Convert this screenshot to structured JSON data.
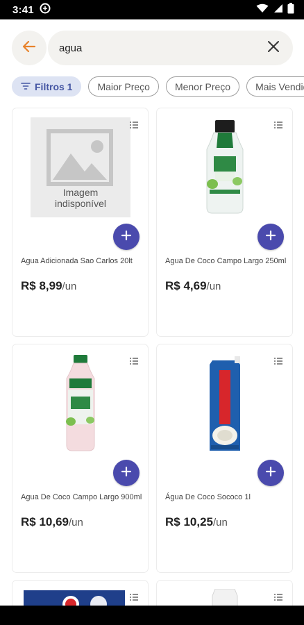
{
  "status_bar": {
    "time": "3:41",
    "icons": [
      "circle-app-icon",
      "wifi-icon",
      "signal-icon",
      "battery-icon"
    ]
  },
  "search": {
    "back_icon": "arrow-left-icon",
    "query": "agua",
    "clear_icon": "close-icon",
    "accent_color": "#e8822a"
  },
  "filters": {
    "chips": [
      {
        "label": "Filtros 1",
        "active": true,
        "icon": "filter-icon"
      },
      {
        "label": "Maior Preço",
        "active": false
      },
      {
        "label": "Menor Preço",
        "active": false
      },
      {
        "label": "Mais Vendidos",
        "active": false
      }
    ]
  },
  "products": [
    {
      "name": "Agua Adicionada Sao Carlos 20lt",
      "price": "R$ 8,99",
      "unit": "/un",
      "image": "image-unavailable-placeholder",
      "placeholder_text_1": "Imagem",
      "placeholder_text_2": "indisponível"
    },
    {
      "name": "Agua De Coco Campo Largo 250ml",
      "price": "R$ 4,69",
      "unit": "/un",
      "image": "small-coconut-water-bottle"
    },
    {
      "name": "Agua De Coco Campo Largo 900ml",
      "price": "R$ 10,69",
      "unit": "/un",
      "image": "large-coconut-water-bottle"
    },
    {
      "name": "Água De Coco Sococo 1l",
      "price": "R$ 10,25",
      "unit": "/un",
      "image": "sococo-carton"
    }
  ],
  "colors": {
    "add_button": "#4a4aad",
    "chip_active_bg": "#dde3f3",
    "chip_active_text": "#4556a3"
  }
}
